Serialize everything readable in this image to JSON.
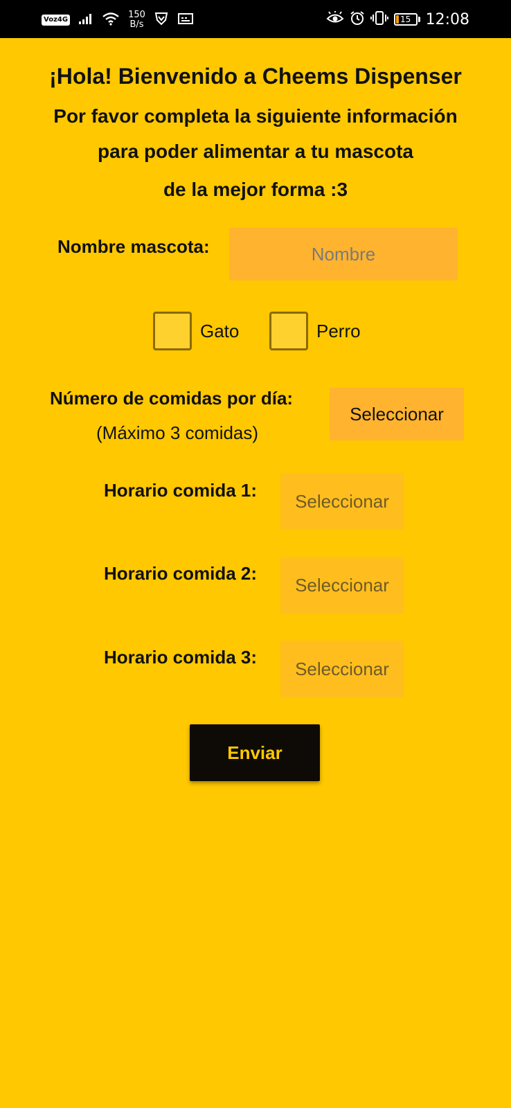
{
  "status_bar": {
    "network_badge": "Voz4G",
    "speed_value": "150",
    "speed_unit": "B/s",
    "battery_level": "15",
    "time": "12:08",
    "icons": [
      "signal-icon",
      "wifi-icon",
      "vpn-shield-icon",
      "screenshot-icon",
      "eye-comfort-icon",
      "alarm-icon",
      "vibrate-icon",
      "battery-icon"
    ]
  },
  "header": {
    "title": "¡Hola! Bienvenido a Cheems Dispenser",
    "line1": "Por favor completa la siguiente información",
    "line2": "para poder alimentar a tu mascota",
    "line3": "de la mejor forma :3"
  },
  "form": {
    "pet_name": {
      "label": "Nombre mascota:",
      "value": "",
      "placeholder": "Nombre"
    },
    "pet_type": {
      "options": [
        {
          "label": "Gato",
          "checked": false
        },
        {
          "label": "Perro",
          "checked": false
        }
      ]
    },
    "meals": {
      "label": "Número de comidas por día:",
      "hint": "(Máximo 3 comidas)",
      "button": "Seleccionar"
    },
    "schedules": [
      {
        "label": "Horario comida 1:",
        "value": "Seleccionar"
      },
      {
        "label": "Horario comida 2:",
        "value": "Seleccionar"
      },
      {
        "label": "Horario comida 3:",
        "value": "Seleccionar"
      }
    ],
    "submit": "Enviar"
  },
  "colors": {
    "background": "#FFC800",
    "field": "#FFB32F",
    "button": "#0E0B07",
    "button_text": "#FFC800"
  }
}
